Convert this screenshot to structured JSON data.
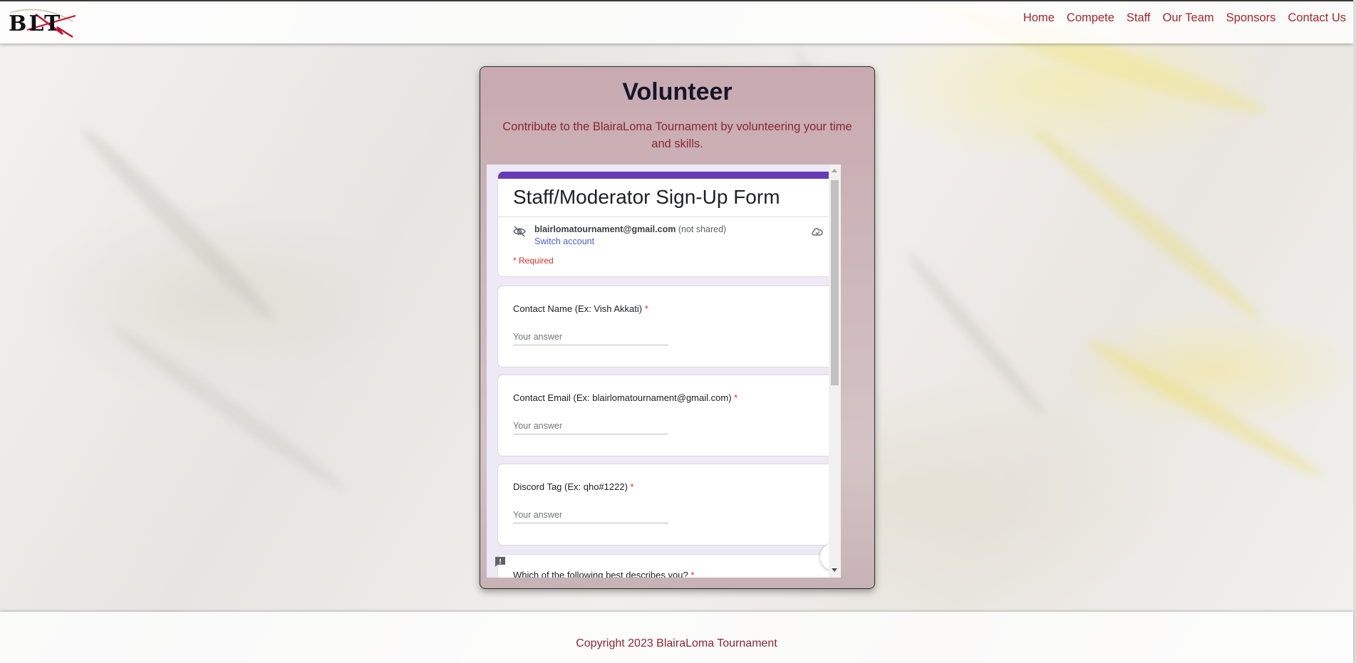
{
  "header": {
    "logo_text": "BLT",
    "nav": [
      "Home",
      "Compete",
      "Staff",
      "Our Team",
      "Sponsors",
      "Contact Us"
    ]
  },
  "volunteer": {
    "title": "Volunteer",
    "subtitle": "Contribute to the BlairaLoma Tournament by volunteering your time and skills."
  },
  "form": {
    "title": "Staff/Moderator Sign-Up Form",
    "account_email": "blairlomatournament@gmail.com",
    "account_note": "(not shared)",
    "switch_account": "Switch account",
    "required_note": "* Required",
    "questions": [
      {
        "label": "Contact Name (Ex: Vish Akkati)",
        "required_mark": "*",
        "placeholder": "Your answer"
      },
      {
        "label": "Contact Email (Ex: blairlomatournament@gmail.com)",
        "required_mark": "*",
        "placeholder": "Your answer"
      },
      {
        "label": "Discord Tag (Ex: qho#1222)",
        "required_mark": "*",
        "placeholder": "Your answer"
      },
      {
        "label": "Which of the following best describes you?",
        "required_mark": "*"
      }
    ]
  },
  "footer": {
    "copyright": "Copyright 2023 BlairaLoma Tournament"
  },
  "colors": {
    "accent": "#a3262d",
    "form_bar": "#673ab7",
    "link": "#4d5fc9",
    "required": "#d93025"
  }
}
